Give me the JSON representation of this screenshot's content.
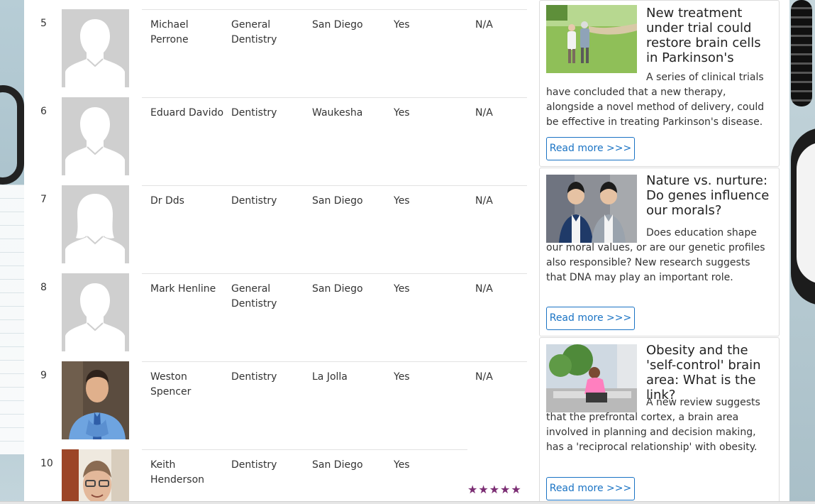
{
  "rows": [
    {
      "num": "5",
      "name": "Michael Perrone",
      "specialty": "General Dentistry",
      "city": "San Diego",
      "accepting": "Yes",
      "rating": "N/A",
      "photo": "placeholder-male"
    },
    {
      "num": "6",
      "name": "Eduard Davido",
      "specialty": "Dentistry",
      "city": "Waukesha",
      "accepting": "Yes",
      "rating": "N/A",
      "photo": "placeholder-male"
    },
    {
      "num": "7",
      "name": "Dr Dds",
      "specialty": "Dentistry",
      "city": "San Diego",
      "accepting": "Yes",
      "rating": "N/A",
      "photo": "placeholder-female"
    },
    {
      "num": "8",
      "name": "Mark Henline",
      "specialty": "General Dentistry",
      "city": "San Diego",
      "accepting": "Yes",
      "rating": "N/A",
      "photo": "placeholder-male"
    },
    {
      "num": "9",
      "name": "Weston Spencer",
      "specialty": "Dentistry",
      "city": "La Jolla",
      "accepting": "Yes",
      "rating": "N/A",
      "photo": "photo"
    },
    {
      "num": "10",
      "name": "Keith Henderson",
      "specialty": "Dentistry",
      "city": "San Diego",
      "accepting": "Yes",
      "rating": "★★★★★",
      "photo": "photo"
    }
  ],
  "news": [
    {
      "title": "New treatment under trial could restore brain cells in Parkinson's",
      "body": "A series of clinical trials have concluded that a new therapy, alongside a novel method of delivery, could be effective in treating Parkinson's disease.",
      "button": "Read more >>>"
    },
    {
      "title": "Nature vs. nurture: Do genes influence our morals?",
      "body": "Does education shape our moral values, or are our genetic profiles also responsible? New research suggests that DNA may play an important role.",
      "button": "Read more >>>"
    },
    {
      "title": "Obesity and the 'self-control' brain area: What is the link?",
      "body": "A new review suggests that the prefrontal cortex, a brain area involved in planning and decision making, has a 'reciprocal relationship' with obesity.",
      "button": "Read more >>>"
    }
  ],
  "colors": {
    "accent": "#1a73c4",
    "star": "#7b2d73"
  }
}
